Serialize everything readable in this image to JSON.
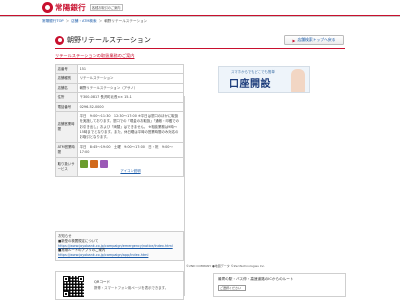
{
  "header": {
    "brand_name": "常陽銀行",
    "brand_tag": "各種お取引のご案内"
  },
  "breadcrumb": {
    "home": "常陽銀行TOP",
    "sep1": "＞",
    "level2": "店舗・ATM検索",
    "sep2": "＞",
    "current": "朝野リテールステーション"
  },
  "page": {
    "title": "朝野リテールステーション",
    "back_label": "店舗検索トップへ戻る",
    "subtitle": "リテールステーションの取扱業務のご案内"
  },
  "info": {
    "rows": [
      {
        "key": "店番号",
        "value": "151"
      },
      {
        "key": "店舗種別",
        "value": "リテールステーション"
      },
      {
        "key": "店舗名",
        "value": "朝野リテールステーション（アサノ）"
      },
      {
        "key": "住所",
        "value": "〒300-0817 長沢町北長×× 15-1"
      },
      {
        "key": "電話番号",
        "value": "0296-52-0000"
      },
      {
        "key": "店舗営業時間",
        "value": "平日　9:00～11:30　12:30～17:00 ※平日は窓口のほかに取扱を実施しております。窓口での「現金のお取扱」「通帳・印鑑でのお引き出し」および「両替」はできません。 ※相談業務は9時～15時までとなります。また、休日曜は平時の営業時間のみ対応のお取引となります。"
      },
      {
        "key": "ATM営業時間",
        "value": "平日　8:45～19:00　土曜　9:00～17:00　日・祝　9:00～17:00"
      },
      {
        "key": "取り扱いサービス",
        "value": ""
      }
    ],
    "service_link": "アイコン説明"
  },
  "notice": {
    "head": "お知らせ",
    "line1": "■新型の検閲規定について",
    "url1": "https://www.joyobank.co.jp/campaign/emergency/notice/index.html",
    "line2": "■常陽ルートのアプリのご案内",
    "url2": "https://www.joyobank.co.jp/campaign/app/index.html"
  },
  "ad": {
    "top_text": "スマホからでもどこでも簡単",
    "main_text": "口座開設"
  },
  "map": {
    "attribution": "©2ND COMPANY ●地図データ ©ZenTechnologies Inc."
  },
  "qr": {
    "title": "QRコード",
    "desc": "携帯・スマートフォン用ページを表示できます。"
  },
  "nearest": {
    "label": "最寄の駅・バス停・高速道路のICからのルート",
    "select_value": "ご選択ください"
  },
  "colors": {
    "brand_red": "#c8102e",
    "link_blue": "#1a5aa8",
    "service_icons": [
      "#6b9c2e",
      "#d16a1c",
      "#9b59b6"
    ]
  }
}
